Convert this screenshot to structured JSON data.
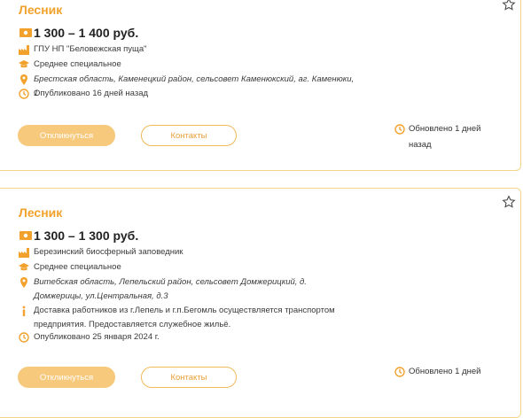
{
  "colors": {
    "accent": "#f2a22c",
    "button_fill": "#f6c97c",
    "border": "#f3d58a"
  },
  "cards": [
    {
      "title": "Лесник",
      "salary": "1 300 – 1 400 руб.",
      "employer": "ГПУ НП \"Беловежская пуща\"",
      "education": "Среднее специальное",
      "address": "Брестская область, Каменецкий район, сельсовет Каменюкский, аг. Каменюки, 1",
      "published": "Опубликовано 16 дней назад",
      "apply_label": "Откликнуться",
      "contacts_label": "Контакты",
      "updated": "Обновлено 1 дней назад"
    },
    {
      "title": "Лесник",
      "salary": "1 300 – 1 300 руб.",
      "employer": "Березинский биосферный заповедник",
      "education": "Среднее специальное",
      "address": "Витебская область, Лепельский район, сельсовет Домжерицкий, д. Домжерицы, ул.Центральная, д.3",
      "info": "Доставка работников из г.Лепель и г.п.Бегомль осуществляется транспортом предприятия. Предоставляется служебное жильё.",
      "published": "Опубликовано 25 января 2024 г.",
      "apply_label": "Откликнуться",
      "contacts_label": "Контакты",
      "updated": "Обновлено 1 дней"
    }
  ]
}
